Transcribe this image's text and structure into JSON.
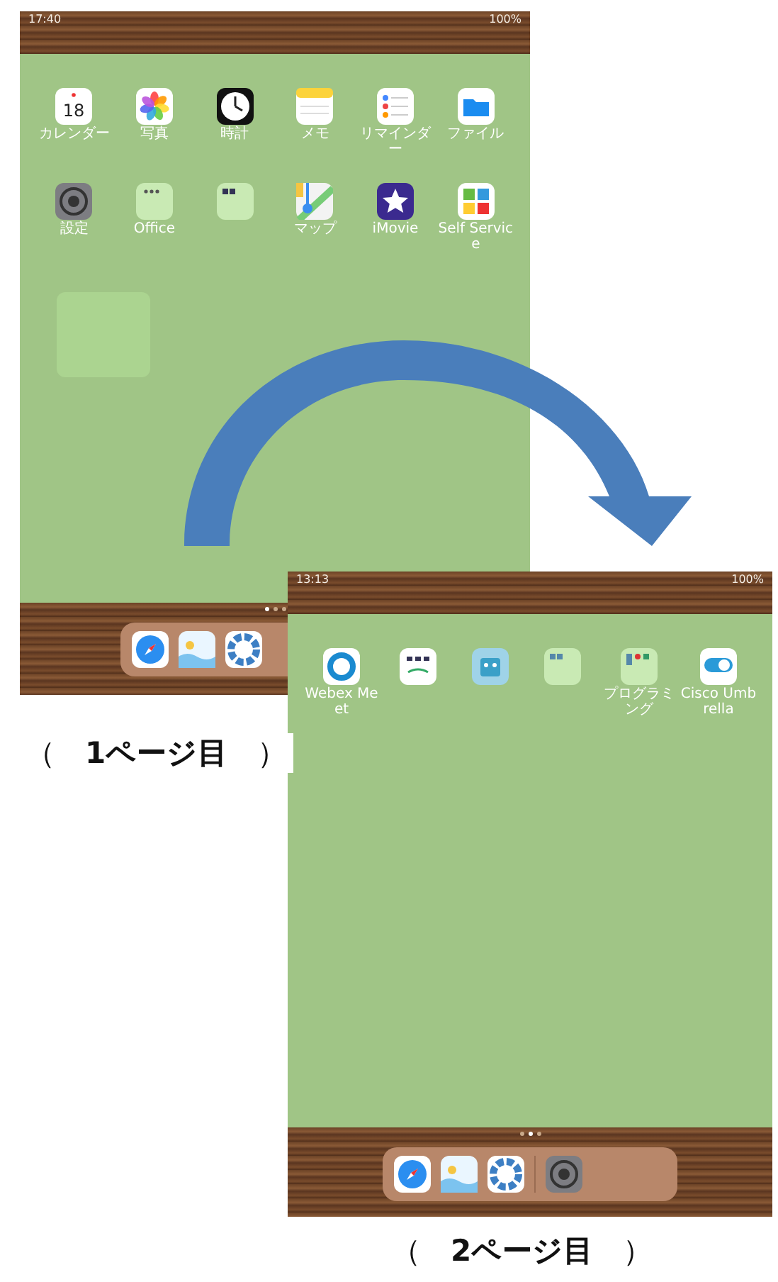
{
  "page_1": {
    "status_time": "17:40",
    "status_battery": "100%",
    "rows": [
      [
        {
          "kind": "labeled",
          "label": "カレンダー",
          "day": "18"
        },
        {
          "kind": "labeled",
          "label": "写真"
        },
        {
          "kind": "labeled",
          "label": "時計"
        },
        {
          "kind": "labeled",
          "label": "メモ"
        },
        {
          "kind": "labeled",
          "label": "リマインダー"
        },
        {
          "kind": "labeled",
          "label": "ファイル"
        }
      ],
      [
        {
          "kind": "labeled",
          "label": "設定"
        },
        {
          "kind": "labeled",
          "label": "Office"
        },
        {
          "kind": "unlabeled"
        },
        {
          "kind": "labeled",
          "label": "マップ"
        },
        {
          "kind": "labeled",
          "label": "iMovie"
        },
        {
          "kind": "labeled",
          "label": "Self Service"
        }
      ]
    ],
    "caption": "（　**1ページ目**　）"
  },
  "page_2": {
    "status_time": "13:13",
    "status_battery": "100%",
    "rows": [
      [
        {
          "kind": "labeled",
          "label": "Webex Meet"
        },
        {
          "kind": "unlabeled"
        },
        {
          "kind": "unlabeled"
        },
        {
          "kind": "unlabeled"
        },
        {
          "kind": "labeled",
          "label": "プログラミング"
        },
        {
          "kind": "labeled",
          "label": "Cisco Umbrella"
        }
      ]
    ],
    "caption": "（　**2ページ目**　）"
  }
}
